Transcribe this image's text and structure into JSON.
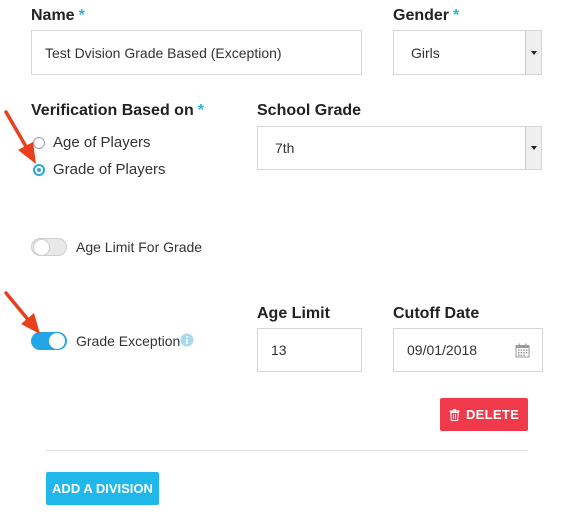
{
  "name": {
    "label": "Name",
    "required": "*",
    "value": "Test Dvision Grade Based (Exception)"
  },
  "gender": {
    "label": "Gender",
    "required": "*",
    "selected": "Girls"
  },
  "verification": {
    "label": "Verification Based on",
    "required": "*",
    "options": [
      {
        "label": "Age of Players",
        "checked": false
      },
      {
        "label": "Grade of Players",
        "checked": true
      }
    ]
  },
  "school_grade": {
    "label": "School Grade",
    "selected": "7th"
  },
  "age_limit_toggle": {
    "label": "Age Limit For Grade",
    "on": false
  },
  "grade_exception_toggle": {
    "label": "Grade Exception",
    "on": true,
    "info_icon": "info-icon"
  },
  "age_limit": {
    "label": "Age Limit",
    "value": "13"
  },
  "cutoff_date": {
    "label": "Cutoff Date",
    "value": "09/01/2018",
    "icon": "calendar-icon"
  },
  "buttons": {
    "delete": "DELETE",
    "add_division": "ADD A DIVISION"
  },
  "colors": {
    "accent": "#24a6e6",
    "danger": "#f0394a",
    "add": "#20b8ea",
    "arrow": "#e8401c"
  }
}
